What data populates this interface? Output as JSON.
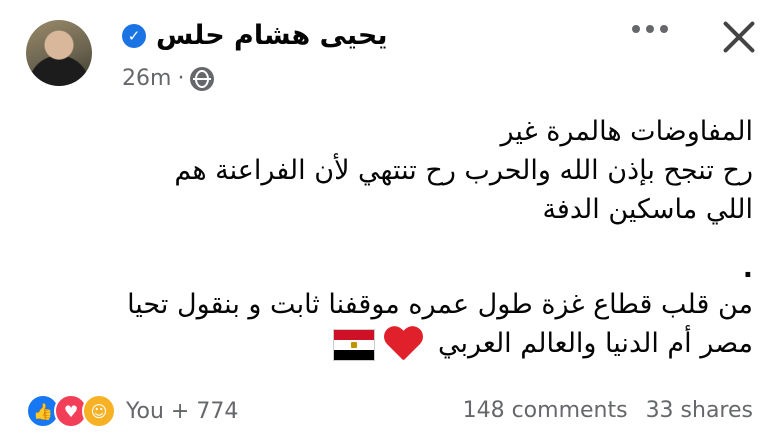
{
  "post": {
    "author": "يحيى هشام حلس",
    "time": "26m",
    "separator": "·",
    "lines": [
      "المفاوضات هالمرة غير",
      "رح تنجح بإذن الله والحرب رح تنتهي  لأن الفراعنة هم",
      "اللي ماسكين الدفة",
      ".",
      "من قلب قطاع غزة طول عمره موقفنا ثابت و بنقول تحيا",
      "مصر أم الدنيا والعالم العربي"
    ]
  },
  "footer": {
    "reactions_text": "You + 774",
    "comments": "148 comments",
    "shares": "33 shares"
  },
  "icons": {
    "verified": "verified-badge-icon",
    "audience": "globe-icon",
    "more": "more-dots-icon",
    "close": "close-icon",
    "reactions": [
      "like-icon",
      "love-icon",
      "care-icon"
    ],
    "emojis": [
      "heart-emoji",
      "egypt-flag-emoji"
    ]
  },
  "colors": {
    "accent": "#1b74e4",
    "secondary_text": "#65676b",
    "like": "#1877f2",
    "love": "#f33e58",
    "care": "#f7b125"
  }
}
